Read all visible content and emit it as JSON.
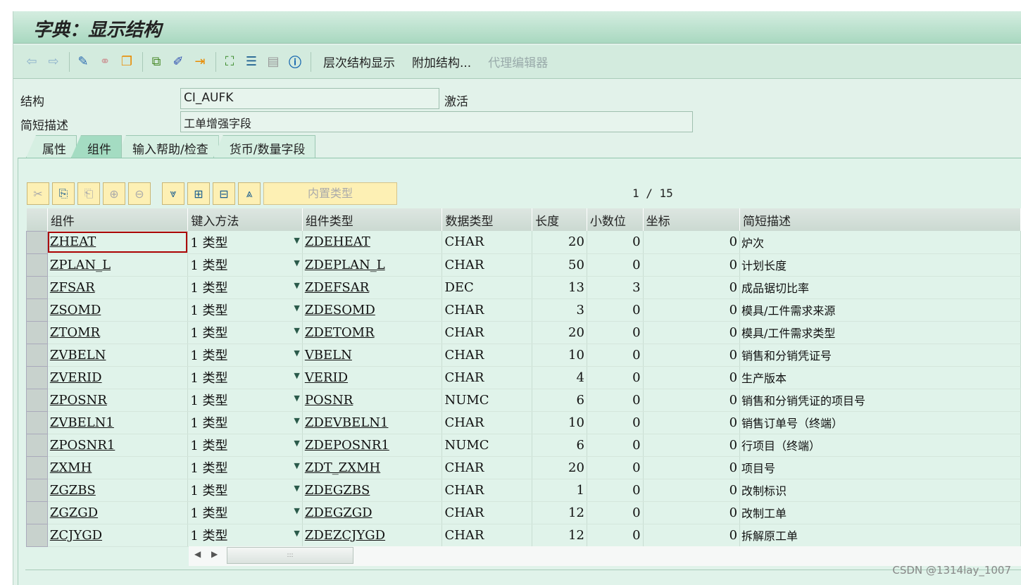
{
  "title": "字典：显示结构",
  "toolbar": {
    "hierarchy": "层次结构显示",
    "append": "附加结构...",
    "proxy": "代理编辑器"
  },
  "form": {
    "struct_label": "结构",
    "struct_value": "CI_AUFK",
    "status": "激活",
    "desc_label": "简短描述",
    "desc_value": "工单增强字段"
  },
  "tabs": [
    "属性",
    "组件",
    "输入帮助/检查",
    "货币/数量字段"
  ],
  "active_tab": "组件",
  "table_toolbar": {
    "builtin": "内置类型",
    "pager": "1 / 15"
  },
  "columns": [
    "组件",
    "键入方法",
    "组件类型",
    "数据类型",
    "长度",
    "小数位",
    "坐标",
    "简短描述"
  ],
  "rows": [
    {
      "comp": "ZHEAT",
      "entry": "1 类型",
      "type": "ZDEHEAT",
      "dtype": "CHAR",
      "len": "20",
      "dec": "0",
      "coord": "0",
      "desc": "炉次"
    },
    {
      "comp": "ZPLAN_L",
      "entry": "1 类型",
      "type": "ZDEPLAN_L",
      "dtype": "CHAR",
      "len": "50",
      "dec": "0",
      "coord": "0",
      "desc": "计划长度"
    },
    {
      "comp": "ZFSAR",
      "entry": "1 类型",
      "type": "ZDEFSAR",
      "dtype": "DEC",
      "len": "13",
      "dec": "3",
      "coord": "0",
      "desc": "成品锯切比率"
    },
    {
      "comp": "ZSOMD",
      "entry": "1 类型",
      "type": "ZDESOMD",
      "dtype": "CHAR",
      "len": "3",
      "dec": "0",
      "coord": "0",
      "desc": "模具/工件需求来源"
    },
    {
      "comp": "ZTOMR",
      "entry": "1 类型",
      "type": "ZDETOMR",
      "dtype": "CHAR",
      "len": "20",
      "dec": "0",
      "coord": "0",
      "desc": "模具/工件需求类型"
    },
    {
      "comp": "ZVBELN",
      "entry": "1 类型",
      "type": "VBELN",
      "dtype": "CHAR",
      "len": "10",
      "dec": "0",
      "coord": "0",
      "desc": "销售和分销凭证号"
    },
    {
      "comp": "ZVERID",
      "entry": "1 类型",
      "type": "VERID",
      "dtype": "CHAR",
      "len": "4",
      "dec": "0",
      "coord": "0",
      "desc": "生产版本"
    },
    {
      "comp": "ZPOSNR",
      "entry": "1 类型",
      "type": "POSNR",
      "dtype": "NUMC",
      "len": "6",
      "dec": "0",
      "coord": "0",
      "desc": "销售和分销凭证的项目号"
    },
    {
      "comp": "ZVBELN1",
      "entry": "1 类型",
      "type": "ZDEVBELN1",
      "dtype": "CHAR",
      "len": "10",
      "dec": "0",
      "coord": "0",
      "desc": "销售订单号（终端）"
    },
    {
      "comp": "ZPOSNR1",
      "entry": "1 类型",
      "type": "ZDEPOSNR1",
      "dtype": "NUMC",
      "len": "6",
      "dec": "0",
      "coord": "0",
      "desc": "行项目（终端）"
    },
    {
      "comp": "ZXMH",
      "entry": "1 类型",
      "type": "ZDT_ZXMH",
      "dtype": "CHAR",
      "len": "20",
      "dec": "0",
      "coord": "0",
      "desc": "项目号"
    },
    {
      "comp": "ZGZBS",
      "entry": "1 类型",
      "type": "ZDEGZBS",
      "dtype": "CHAR",
      "len": "1",
      "dec": "0",
      "coord": "0",
      "desc": "改制标识"
    },
    {
      "comp": "ZGZGD",
      "entry": "1 类型",
      "type": "ZDEGZGD",
      "dtype": "CHAR",
      "len": "12",
      "dec": "0",
      "coord": "0",
      "desc": "改制工单"
    },
    {
      "comp": "ZCJYGD",
      "entry": "1 类型",
      "type": "ZDEZCJYGD",
      "dtype": "CHAR",
      "len": "12",
      "dec": "0",
      "coord": "0",
      "desc": "拆解原工单"
    }
  ],
  "watermark": "CSDN @1314lay_1007"
}
